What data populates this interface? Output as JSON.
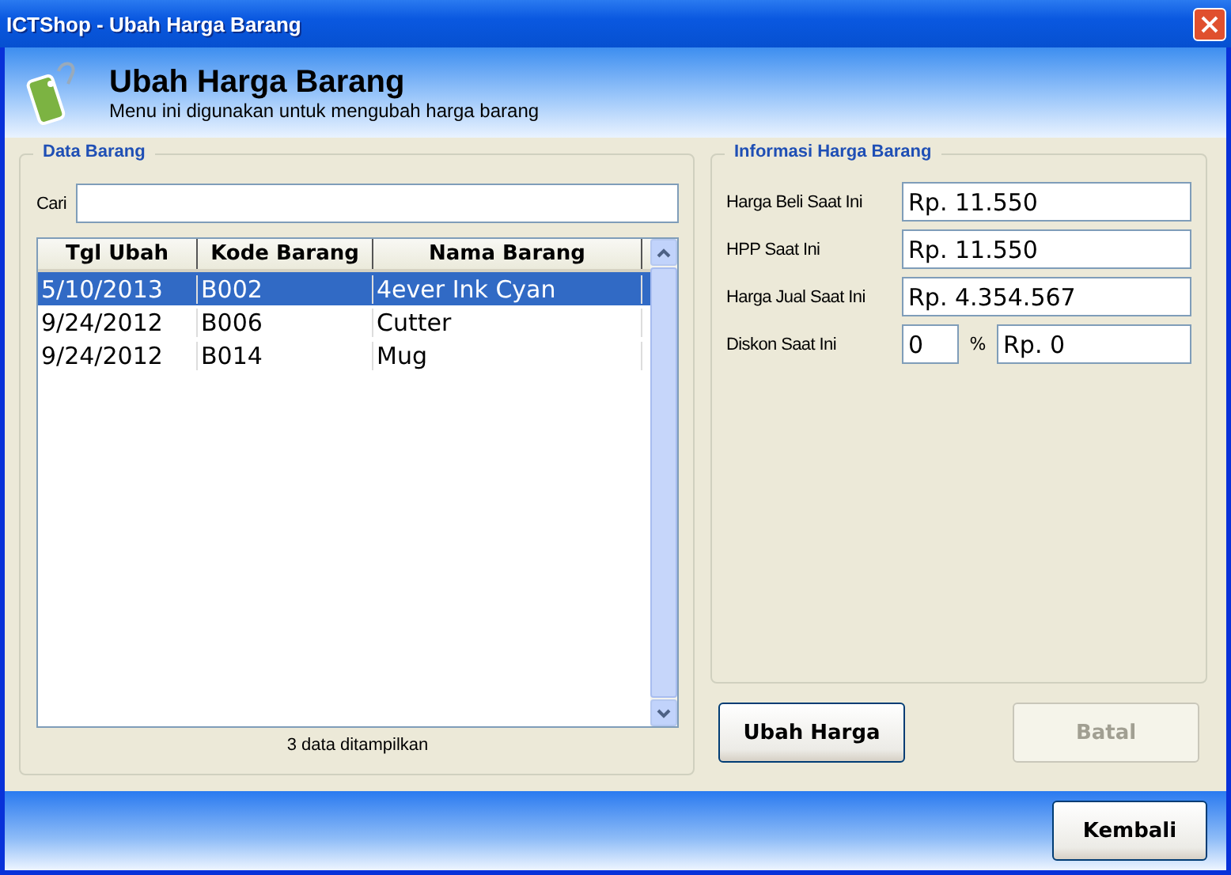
{
  "window": {
    "title": "ICTShop - Ubah Harga Barang"
  },
  "header": {
    "title": "Ubah Harga Barang",
    "subtitle": "Menu ini digunakan untuk mengubah harga barang"
  },
  "data_barang": {
    "title": "Data Barang",
    "search": {
      "label": "Cari"
    },
    "table": {
      "columns": [
        "Tgl Ubah",
        "Kode Barang",
        "Nama Barang"
      ],
      "rows": [
        {
          "cells": [
            "5/10/2013",
            "B002",
            "4ever Ink Cyan"
          ],
          "selected": true
        },
        {
          "cells": [
            "9/24/2012",
            "B006",
            "Cutter"
          ],
          "selected": false
        },
        {
          "cells": [
            "9/24/2012",
            "B014",
            "Mug"
          ],
          "selected": false
        }
      ]
    },
    "count": "3 data ditampilkan"
  },
  "informasi": {
    "title": "Informasi Harga Barang",
    "fields": [
      {
        "label": "Harga Beli Saat Ini",
        "value": "Rp. 11.550"
      },
      {
        "label": "HPP Saat Ini",
        "value": "Rp. 11.550"
      },
      {
        "label": "Harga Jual Saat Ini",
        "value": "Rp. 4.354.567"
      }
    ],
    "discount": {
      "label": "Diskon Saat Ini",
      "percent": "0",
      "percent_sign": "%",
      "amount": "Rp. 0"
    }
  },
  "buttons": [
    {
      "label": "Ubah Harga",
      "disabled": false
    },
    {
      "label": "Batal",
      "disabled": true
    }
  ],
  "footer_button": {
    "label": "Kembali",
    "disabled": false
  }
}
